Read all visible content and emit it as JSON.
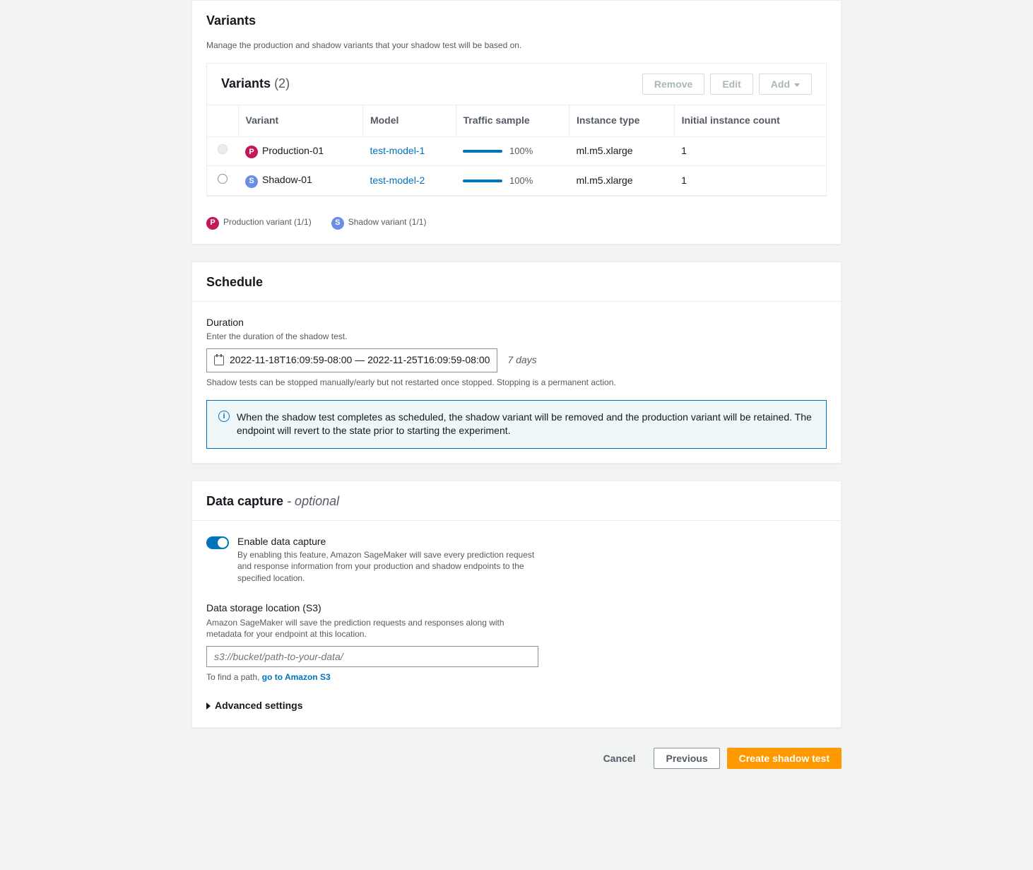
{
  "variants_section": {
    "heading": "Variants",
    "description": "Manage the production and shadow variants that your shadow test will be based on.",
    "card": {
      "title": "Variants",
      "count": "(2)",
      "buttons": {
        "remove": "Remove",
        "edit": "Edit",
        "add": "Add"
      },
      "columns": {
        "variant": "Variant",
        "model": "Model",
        "traffic": "Traffic sample",
        "instance_type": "Instance type",
        "initial_count": "Initial instance count"
      },
      "rows": [
        {
          "badge": "P",
          "badge_kind": "p",
          "name": "Production-01",
          "model": "test-model-1",
          "traffic": "100%",
          "instance_type": "ml.m5.xlarge",
          "count": "1",
          "selectable": false
        },
        {
          "badge": "S",
          "badge_kind": "s",
          "name": "Shadow-01",
          "model": "test-model-2",
          "traffic": "100%",
          "instance_type": "ml.m5.xlarge",
          "count": "1",
          "selectable": true
        }
      ]
    },
    "legend": {
      "production": "Production variant (1/1)",
      "shadow": "Shadow variant (1/1)"
    }
  },
  "schedule": {
    "heading": "Schedule",
    "duration_label": "Duration",
    "duration_help": "Enter the duration of the shadow test.",
    "range_value": "2022-11-18T16:09:59-08:00 — 2022-11-25T16:09:59-08:00",
    "days": "7 days",
    "stop_hint": "Shadow tests can be stopped manually/early but not restarted once stopped. Stopping is a permanent action.",
    "info": "When the shadow test completes as scheduled, the shadow variant will be removed and the production variant will be retained. The endpoint will revert to the state prior to starting the experiment."
  },
  "data_capture": {
    "heading": "Data capture",
    "optional": "- optional",
    "toggle_label": "Enable data capture",
    "toggle_help": "By enabling this feature, Amazon SageMaker will save every prediction request and response information from your production and shadow endpoints to the specified location.",
    "location_label": "Data storage location (S3)",
    "location_help": "Amazon SageMaker will save the prediction requests and responses along with metadata for your endpoint at this location.",
    "placeholder": "s3://bucket/path-to-your-data/",
    "find_path_prefix": "To find a path,",
    "find_path_link": "go to Amazon S3",
    "advanced": "Advanced settings"
  },
  "footer": {
    "cancel": "Cancel",
    "previous": "Previous",
    "create": "Create shadow test"
  }
}
